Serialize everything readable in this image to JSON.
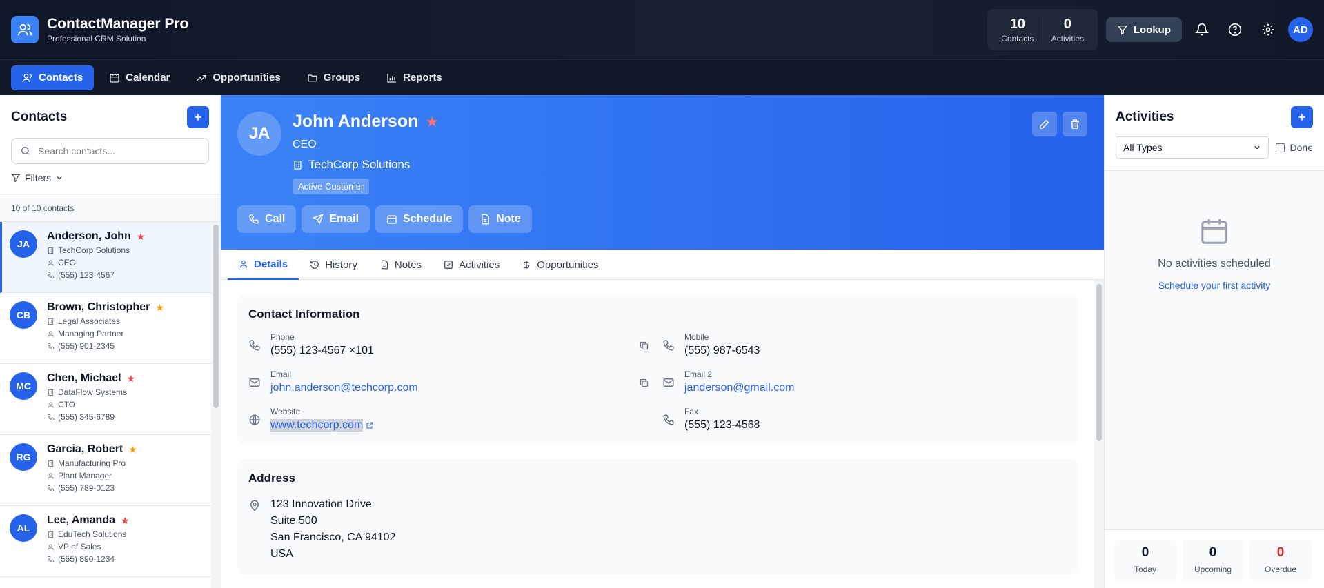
{
  "app": {
    "title": "ContactManager Pro",
    "subtitle": "Professional CRM Solution"
  },
  "header": {
    "stats": [
      {
        "value": "10",
        "label": "Contacts"
      },
      {
        "value": "0",
        "label": "Activities"
      }
    ],
    "lookup_label": "Lookup",
    "user_initials": "AD"
  },
  "nav": [
    {
      "label": "Contacts",
      "icon": "users-icon",
      "active": true
    },
    {
      "label": "Calendar",
      "icon": "calendar-icon"
    },
    {
      "label": "Opportunities",
      "icon": "trend-icon"
    },
    {
      "label": "Groups",
      "icon": "folder-icon"
    },
    {
      "label": "Reports",
      "icon": "bar-chart-icon"
    }
  ],
  "contacts_panel": {
    "title": "Contacts",
    "search_placeholder": "Search contacts...",
    "filters_label": "Filters",
    "count_text": "10 of 10 contacts",
    "items": [
      {
        "initials": "JA",
        "name": "Anderson, John",
        "company": "TechCorp Solutions",
        "role": "CEO",
        "phone": "(555) 123-4567",
        "star_color": "#ef4444"
      },
      {
        "initials": "CB",
        "name": "Brown, Christopher",
        "company": "Legal Associates",
        "role": "Managing Partner",
        "phone": "(555) 901-2345",
        "star_color": "#f59e0b"
      },
      {
        "initials": "MC",
        "name": "Chen, Michael",
        "company": "DataFlow Systems",
        "role": "CTO",
        "phone": "(555) 345-6789",
        "star_color": "#ef4444"
      },
      {
        "initials": "RG",
        "name": "Garcia, Robert",
        "company": "Manufacturing Pro",
        "role": "Plant Manager",
        "phone": "(555) 789-0123",
        "star_color": "#f59e0b"
      },
      {
        "initials": "AL",
        "name": "Lee, Amanda",
        "company": "EduTech Solutions",
        "role": "VP of Sales",
        "phone": "(555) 890-1234",
        "star_color": "#ef4444"
      }
    ]
  },
  "detail": {
    "initials": "JA",
    "name": "John Anderson",
    "title": "CEO",
    "company": "TechCorp Solutions",
    "badge": "Active Customer",
    "actions": [
      {
        "label": "Call",
        "icon": "phone-icon"
      },
      {
        "label": "Email",
        "icon": "send-icon"
      },
      {
        "label": "Schedule",
        "icon": "calendar-icon"
      },
      {
        "label": "Note",
        "icon": "note-icon"
      }
    ],
    "tabs": [
      {
        "label": "Details",
        "icon": "user-icon",
        "active": true
      },
      {
        "label": "History",
        "icon": "history-icon"
      },
      {
        "label": "Notes",
        "icon": "document-icon"
      },
      {
        "label": "Activities",
        "icon": "checkbox-icon"
      },
      {
        "label": "Opportunities",
        "icon": "dollar-icon"
      }
    ],
    "contact_info": {
      "title": "Contact Information",
      "phone": {
        "label": "Phone",
        "value": "(555) 123-4567 ×101"
      },
      "mobile": {
        "label": "Mobile",
        "value": "(555) 987-6543"
      },
      "email": {
        "label": "Email",
        "value": "john.anderson@techcorp.com"
      },
      "email2": {
        "label": "Email 2",
        "value": "janderson@gmail.com"
      },
      "website": {
        "label": "Website",
        "value": "www.techcorp.com"
      },
      "fax": {
        "label": "Fax",
        "value": "(555) 123-4568"
      }
    },
    "address": {
      "title": "Address",
      "line1": "123 Innovation Drive",
      "line2": "Suite 500",
      "line3": "San Francisco, CA 94102",
      "line4": "USA"
    }
  },
  "activities_panel": {
    "title": "Activities",
    "type_selected": "All Types",
    "done_label": "Done",
    "empty_text": "No activities scheduled",
    "empty_link": "Schedule your first activity",
    "footer": [
      {
        "value": "0",
        "label": "Today"
      },
      {
        "value": "0",
        "label": "Upcoming"
      },
      {
        "value": "0",
        "label": "Overdue"
      }
    ]
  }
}
